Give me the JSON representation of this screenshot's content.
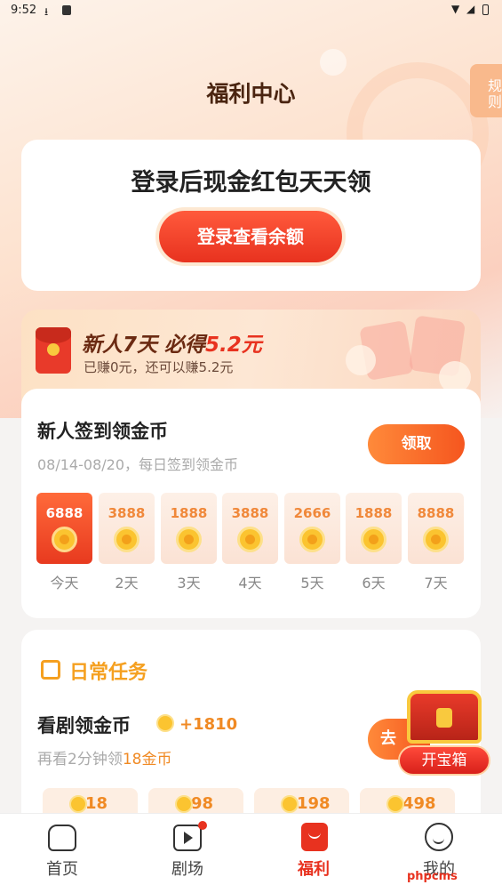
{
  "status_bar": {
    "time": "9:52"
  },
  "header": {
    "title": "福利中心",
    "rules_label": "规则"
  },
  "login_card": {
    "title": "登录后现金红包天天领",
    "button_label": "登录查看余额"
  },
  "new_user_banner": {
    "title_prefix": "新人7天 必得",
    "title_highlight": "5.2元",
    "subtitle": "已赚0元，还可以赚5.2元"
  },
  "signin": {
    "title": "新人签到领金币",
    "subtitle": "08/14-08/20，每日签到领金币",
    "claim_label": "领取",
    "days": [
      {
        "amount": "6888",
        "label": "今天",
        "active": true
      },
      {
        "amount": "3888",
        "label": "2天",
        "active": false
      },
      {
        "amount": "1888",
        "label": "3天",
        "active": false
      },
      {
        "amount": "3888",
        "label": "4天",
        "active": false
      },
      {
        "amount": "2666",
        "label": "5天",
        "active": false
      },
      {
        "amount": "1888",
        "label": "6天",
        "active": false
      },
      {
        "amount": "8888",
        "label": "7天",
        "active": false
      }
    ]
  },
  "daily_tasks": {
    "heading": "日常任务",
    "task": {
      "title": "看剧领金币",
      "reward": "+1810",
      "sub_prefix": "再看2分钟领",
      "sub_highlight": "18金币",
      "go_label": "去"
    },
    "rewards": [
      "18",
      "98",
      "198",
      "498"
    ]
  },
  "treasure": {
    "label": "开宝箱"
  },
  "tabbar": {
    "items": [
      {
        "label": "首页",
        "icon": "home-icon"
      },
      {
        "label": "剧场",
        "icon": "play-icon"
      },
      {
        "label": "福利",
        "icon": "welfare-bag-icon"
      },
      {
        "label": "我的",
        "icon": "profile-face-icon"
      }
    ],
    "active_index": 2
  },
  "watermark": "phpcms",
  "colors": {
    "accent": "#e8321f",
    "gold": "#f5a020",
    "coin": "#fbc430"
  }
}
